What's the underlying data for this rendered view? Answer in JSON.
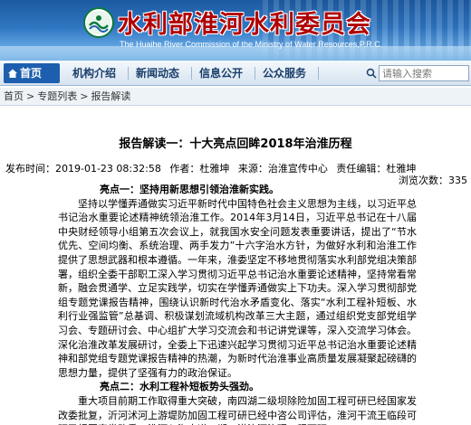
{
  "header": {
    "title_cn": "水利部淮河水利委员会",
    "title_en": "The Huaihe River Commission of the Ministry of Water Resources,P.R.C."
  },
  "nav": {
    "home": "首页",
    "items": [
      "机构介绍",
      "新闻动态",
      "信息公开",
      "公众服务"
    ],
    "search_placeholder": "请输入搜索"
  },
  "breadcrumb": [
    "首页",
    "专题列表",
    "报告解读"
  ],
  "article": {
    "title": "报告解读一：十大亮点回眸2018年治淮历程",
    "publish_time": "发布时间：2019-01-23 08:32:58",
    "author": "作者：杜雅坤",
    "source": "来源：治淮宣传中心",
    "editor": "责任编辑：杜雅坤",
    "views_label": "浏览次数：335",
    "heading1": "亮点一：坚持用新思想引领治淮新实践。",
    "para1": "坚持以学懂弄通做实习近平新时代中国特色社会主义思想为主线，以习近平总书记治水重要论述精神统领治淮工作。2014年3月14日，习近平总书记在十八届中央财经领导小组第五次会议上，就我国水安全问题发表重要讲话，提出了“节水优先、空间均衡、系统治理、两手发力”十六字治水方针，为做好水利和治淮工作提供了思想武器和根本遵循。一年来，淮委坚定不移地贯彻落实水利部党组决策部署，组织全委干部职工深入学习贯彻习近平总书记治水重要论述精神，坚持常看常新，融会贯通学、立足实践学，切实在学懂弄通做实上下功夫。深入学习贯彻部党组专题党课报告精神，围绕认识新时代治水矛盾变化、落实“水利工程补短板、水利行业强监管”总基调、积极谋划流域机构改革三大主题，通过组织党支部党组学习会、专题研讨会、中心组扩大学习交流会和书记讲党课等，深入交流学习体会。深化治淮改革发展研讨，全委上下迅速兴起学习贯彻习近平总书记治水重要论述精神和部党组专题党课报告精神的热潮，为新时代治淮事业高质量发展凝聚起磅礴的思想力量，提供了坚强有力的政治保证。",
    "heading2": "亮点二：水利工程补短板势头强劲。",
    "para2": "重大项目前期工作取得重大突破，南四湖二级坝除险加固工程可研已经国家发改委批复，沂河沭河上游堤防加固工程可研已经中咨公司评估，淮河干流王临段可研已报国家发改委，淮河入海水道二期、洪汝河治理工程可研"
  }
}
